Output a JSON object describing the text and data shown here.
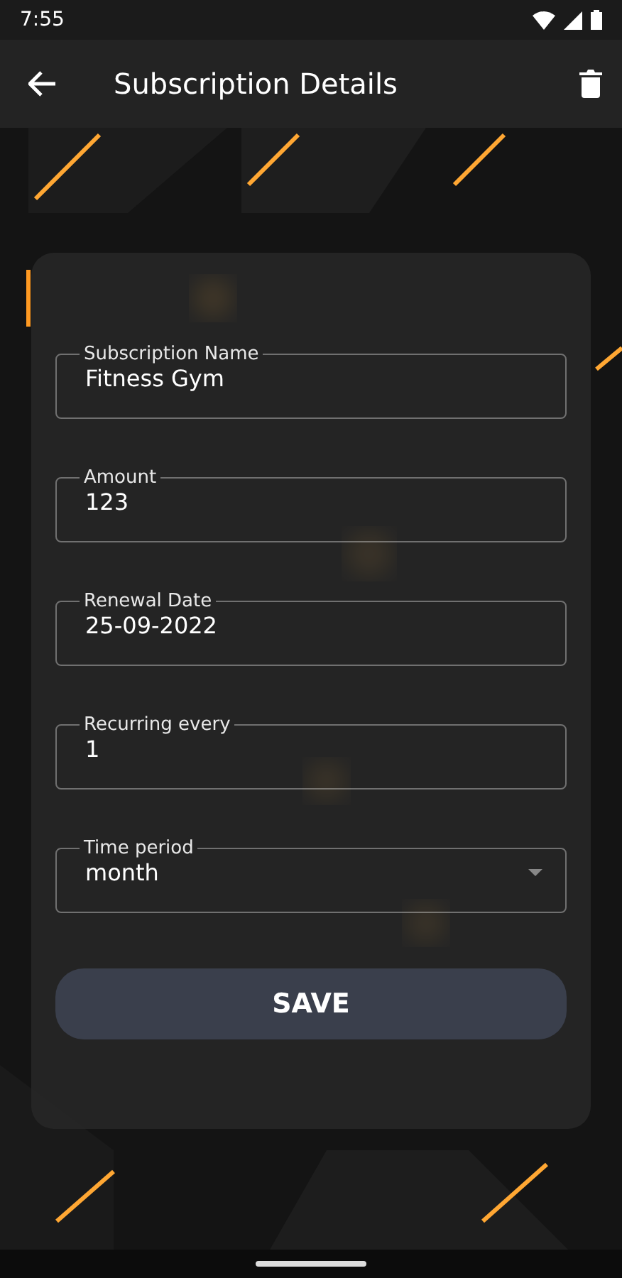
{
  "status_bar": {
    "time": "7:55"
  },
  "app_bar": {
    "title": "Subscription Details"
  },
  "fields": [
    {
      "kind": "text",
      "label": "Subscription Name",
      "value": "Fitness Gym"
    },
    {
      "kind": "text",
      "label": "Amount",
      "value": "123"
    },
    {
      "kind": "text",
      "label": "Renewal Date",
      "value": "25-09-2022"
    },
    {
      "kind": "text",
      "label": "Recurring every",
      "value": "1"
    },
    {
      "kind": "dropdown",
      "label": "Time period",
      "value": "month"
    }
  ],
  "save_button": {
    "label": "SAVE"
  }
}
